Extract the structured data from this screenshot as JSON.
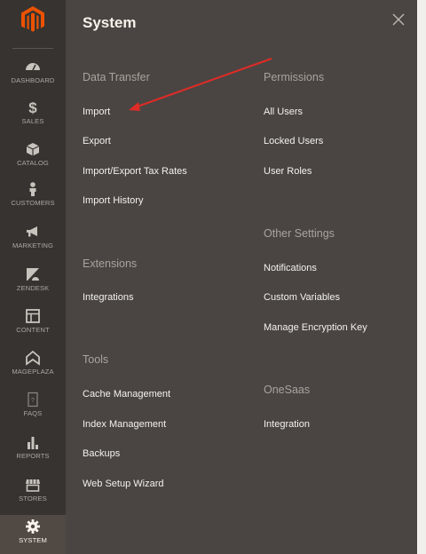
{
  "sidebar": {
    "items": [
      {
        "label": "DASHBOARD",
        "icon": "dashboard-icon"
      },
      {
        "label": "SALES",
        "icon": "dollar-icon"
      },
      {
        "label": "CATALOG",
        "icon": "box-icon"
      },
      {
        "label": "CUSTOMERS",
        "icon": "person-icon"
      },
      {
        "label": "MARKETING",
        "icon": "megaphone-icon"
      },
      {
        "label": "ZENDESK",
        "icon": "zendesk-icon"
      },
      {
        "label": "CONTENT",
        "icon": "layout-icon"
      },
      {
        "label": "MAGEPLAZA",
        "icon": "mageplaza-icon"
      },
      {
        "label": "FAQS",
        "icon": "faq-icon"
      },
      {
        "label": "REPORTS",
        "icon": "bar-chart-icon"
      },
      {
        "label": "STORES",
        "icon": "store-icon"
      },
      {
        "label": "SYSTEM",
        "icon": "gear-icon"
      }
    ],
    "active": "SYSTEM"
  },
  "panel": {
    "title": "System",
    "groups": {
      "data_transfer": {
        "title": "Data Transfer",
        "links": [
          "Import",
          "Export",
          "Import/Export Tax Rates",
          "Import History"
        ]
      },
      "extensions": {
        "title": "Extensions",
        "links": [
          "Integrations"
        ]
      },
      "tools": {
        "title": "Tools",
        "links": [
          "Cache Management",
          "Index Management",
          "Backups",
          "Web Setup Wizard"
        ]
      },
      "permissions": {
        "title": "Permissions",
        "links": [
          "All Users",
          "Locked Users",
          "User Roles"
        ]
      },
      "other_settings": {
        "title": "Other Settings",
        "links": [
          "Notifications",
          "Custom Variables",
          "Manage Encryption Key"
        ]
      },
      "onesaas": {
        "title": "OneSaas",
        "links": [
          "Integration"
        ]
      }
    }
  },
  "colors": {
    "sidebar_bg": "#373330",
    "panel_bg": "#4a4542",
    "brand": "#eb5202",
    "annotation_arrow": "#e02b27"
  }
}
